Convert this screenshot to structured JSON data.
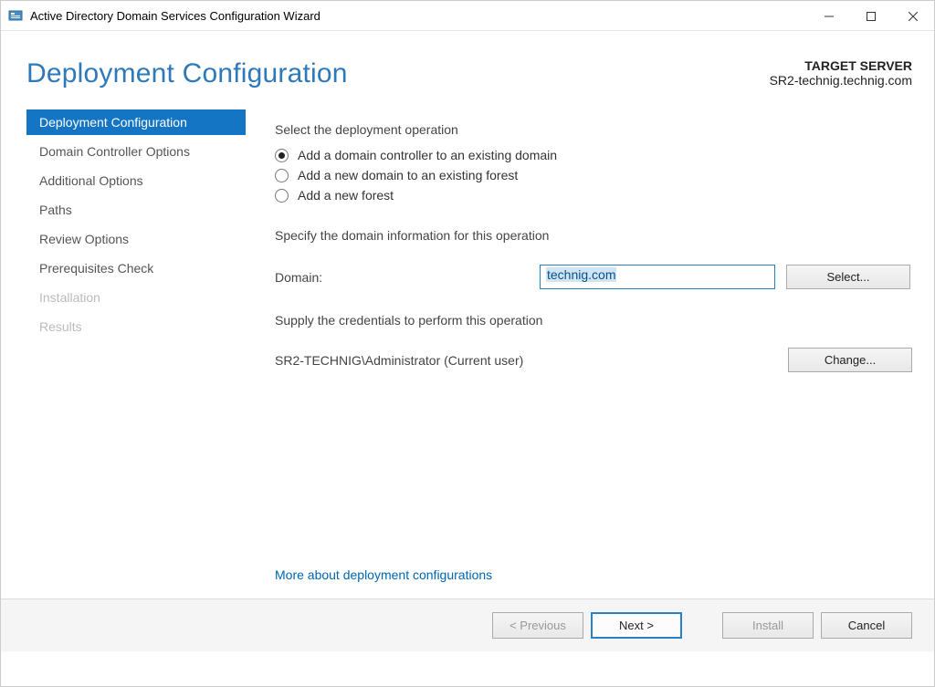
{
  "window": {
    "title": "Active Directory Domain Services Configuration Wizard"
  },
  "header": {
    "page_title": "Deployment Configuration",
    "target_label": "TARGET SERVER",
    "target_server": "SR2-technig.technig.com"
  },
  "sidebar": {
    "items": [
      {
        "label": "Deployment Configuration",
        "state": "active"
      },
      {
        "label": "Domain Controller Options",
        "state": "normal"
      },
      {
        "label": "Additional Options",
        "state": "normal"
      },
      {
        "label": "Paths",
        "state": "normal"
      },
      {
        "label": "Review Options",
        "state": "normal"
      },
      {
        "label": "Prerequisites Check",
        "state": "normal"
      },
      {
        "label": "Installation",
        "state": "disabled"
      },
      {
        "label": "Results",
        "state": "disabled"
      }
    ]
  },
  "main": {
    "select_op_label": "Select the deployment operation",
    "radios": [
      {
        "label": "Add a domain controller to an existing domain",
        "checked": true
      },
      {
        "label": "Add a new domain to an existing forest",
        "checked": false
      },
      {
        "label": "Add a new forest",
        "checked": false
      }
    ],
    "specify_label": "Specify the domain information for this operation",
    "domain_field_label": "Domain:",
    "domain_value": "technig.com",
    "select_button": "Select...",
    "credentials_label": "Supply the credentials to perform this operation",
    "credentials_value": "SR2-TECHNIG\\Administrator (Current user)",
    "change_button": "Change...",
    "more_link": "More about deployment configurations"
  },
  "footer": {
    "previous": "< Previous",
    "next": "Next >",
    "install": "Install",
    "cancel": "Cancel"
  }
}
